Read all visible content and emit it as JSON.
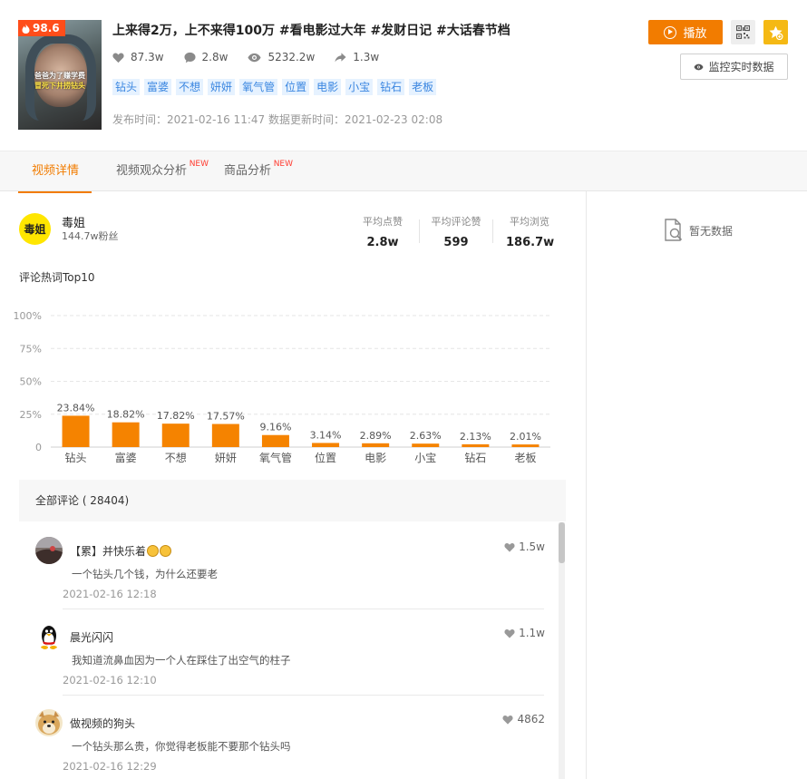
{
  "video": {
    "score": "98.6",
    "title": "上来得2万，上不来得100万 #看电影过大年 #发财日记 #大话春节档",
    "thumb_caption_line1": "爸爸为了赚学费",
    "thumb_caption_line2": "冒死下井捞钻头",
    "stats": [
      {
        "icon": "heart-icon",
        "value": "87.3w"
      },
      {
        "icon": "comment-icon",
        "value": "2.8w"
      },
      {
        "icon": "eye-icon",
        "value": "5232.2w"
      },
      {
        "icon": "share-icon",
        "value": "1.3w"
      }
    ],
    "tags": [
      "钻头",
      "富婆",
      "不想",
      "妍妍",
      "氧气管",
      "位置",
      "电影",
      "小宝",
      "钻石",
      "老板"
    ],
    "times": "发布时间：2021-02-16 11:47 数据更新时间：2021-02-23 02:08"
  },
  "actions": {
    "play_label": "播放",
    "monitor_label": "监控实时数据"
  },
  "tabs": [
    {
      "label": "视频详情",
      "new": ""
    },
    {
      "label": "视频观众分析",
      "new": "NEW"
    },
    {
      "label": "商品分析",
      "new": "NEW"
    }
  ],
  "author": {
    "avatar_text": "毒姐",
    "name": "毒姐",
    "fans": "144.7w粉丝"
  },
  "averages": [
    {
      "label": "平均点赞",
      "value": "2.8w"
    },
    {
      "label": "平均评论赞",
      "value": "599"
    },
    {
      "label": "平均浏览",
      "value": "186.7w"
    }
  ],
  "chart_section_title": "评论热词Top10",
  "chart_data": {
    "type": "bar",
    "title": "评论热词Top10",
    "categories": [
      "钻头",
      "富婆",
      "不想",
      "妍妍",
      "氧气管",
      "位置",
      "电影",
      "小宝",
      "钻石",
      "老板"
    ],
    "values": [
      23.84,
      18.82,
      17.82,
      17.57,
      9.16,
      3.14,
      2.89,
      2.63,
      2.13,
      2.01
    ],
    "value_labels": [
      "23.84%",
      "18.82%",
      "17.82%",
      "17.57%",
      "9.16%",
      "3.14%",
      "2.89%",
      "2.63%",
      "2.13%",
      "2.01%"
    ],
    "yticks": [
      "0",
      "25%",
      "50%",
      "75%",
      "100%"
    ],
    "ylim": [
      0,
      100
    ],
    "grid": true,
    "bar_color": "#f58300"
  },
  "comments": {
    "header": "全部评论 ( 28404)",
    "items": [
      {
        "name": "【累】并快乐着",
        "has_emoji": true,
        "text": "一个钻头几个钱，为什么还要老",
        "time": "2021-02-16 12:18",
        "likes": "1.5w",
        "avatar": "photo-avatar"
      },
      {
        "name": "晨光闪闪",
        "has_emoji": false,
        "text": "我知道流鼻血因为一个人在踩住了出空气的柱子",
        "time": "2021-02-16 12:10",
        "likes": "1.1w",
        "avatar": "penguin-avatar"
      },
      {
        "name": "做视频的狗头",
        "has_emoji": false,
        "text": "一个钻头那么贵，你觉得老板能不要那个钻头吗",
        "time": "2021-02-16 12:29",
        "likes": "4862",
        "avatar": "dog-avatar"
      }
    ]
  },
  "side_panel": {
    "no_data": "暂无数据"
  }
}
